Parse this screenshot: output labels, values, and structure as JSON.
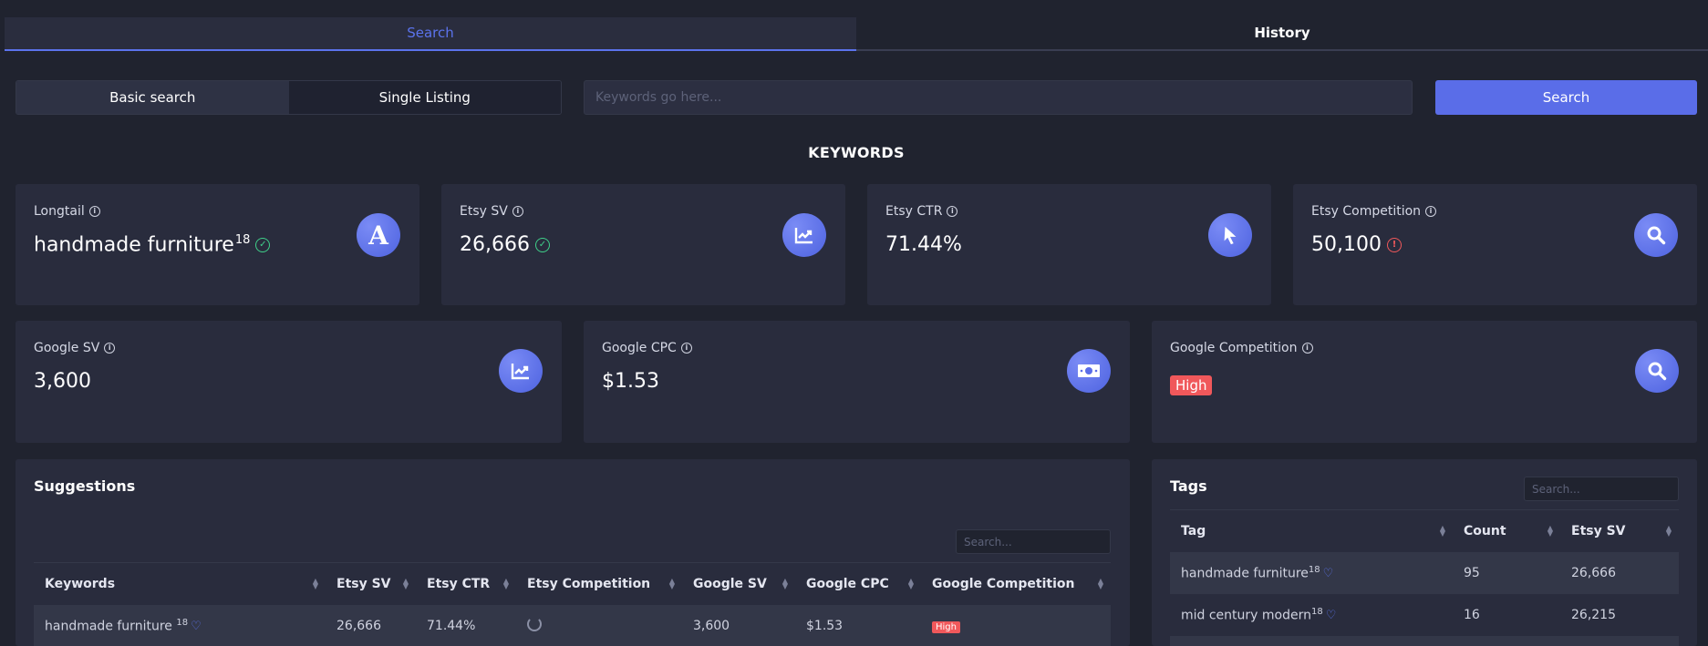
{
  "tabs": [
    {
      "label": "Search",
      "active": true
    },
    {
      "label": "History",
      "active": false
    }
  ],
  "search_modes": [
    {
      "label": "Basic search",
      "active": true
    },
    {
      "label": "Single Listing",
      "active": false
    }
  ],
  "search": {
    "placeholder": "Keywords go here...",
    "value": "",
    "button_label": "Search"
  },
  "section_title": "KEYWORDS",
  "metrics_row1": [
    {
      "label": "Longtail",
      "value": "handmade furniture",
      "sup": "18",
      "status": "ok",
      "icon": "letter-a-icon"
    },
    {
      "label": "Etsy SV",
      "value": "26,666",
      "status": "ok",
      "icon": "chart-up-icon"
    },
    {
      "label": "Etsy CTR",
      "value": "71.44%",
      "icon": "cursor-icon"
    },
    {
      "label": "Etsy Competition",
      "value": "50,100",
      "status": "warn",
      "icon": "search-icon"
    }
  ],
  "metrics_row2": [
    {
      "label": "Google SV",
      "value": "3,600",
      "icon": "chart-up-icon"
    },
    {
      "label": "Google CPC",
      "value": "$1.53",
      "icon": "money-icon"
    },
    {
      "label": "Google Competition",
      "badge": "High",
      "icon": "search-icon"
    }
  ],
  "suggestions": {
    "title": "Suggestions",
    "search_placeholder": "Search...",
    "columns": [
      "Keywords",
      "Etsy SV",
      "Etsy CTR",
      "Etsy Competition",
      "Google SV",
      "Google CPC",
      "Google Competition"
    ],
    "rows": [
      {
        "keyword": "handmade furniture",
        "sup": "18",
        "etsy_sv": "26,666",
        "etsy_ctr": "71.44%",
        "etsy_competition": "loading",
        "google_sv": "3,600",
        "google_cpc": "$1.53",
        "google_competition": "High"
      }
    ]
  },
  "tags": {
    "title": "Tags",
    "search_placeholder": "Search...",
    "columns": [
      "Tag",
      "Count",
      "Etsy SV"
    ],
    "rows": [
      {
        "tag": "handmade furniture",
        "sup": "18",
        "count": "95",
        "etsy_sv": "26,666"
      },
      {
        "tag": "mid century modern",
        "sup": "18",
        "count": "16",
        "etsy_sv": "26,215"
      }
    ]
  },
  "colors": {
    "background": "#20232f",
    "card": "#292c3d",
    "accent": "#5a6de8",
    "success": "#3fd08a",
    "danger": "#f0585b"
  }
}
